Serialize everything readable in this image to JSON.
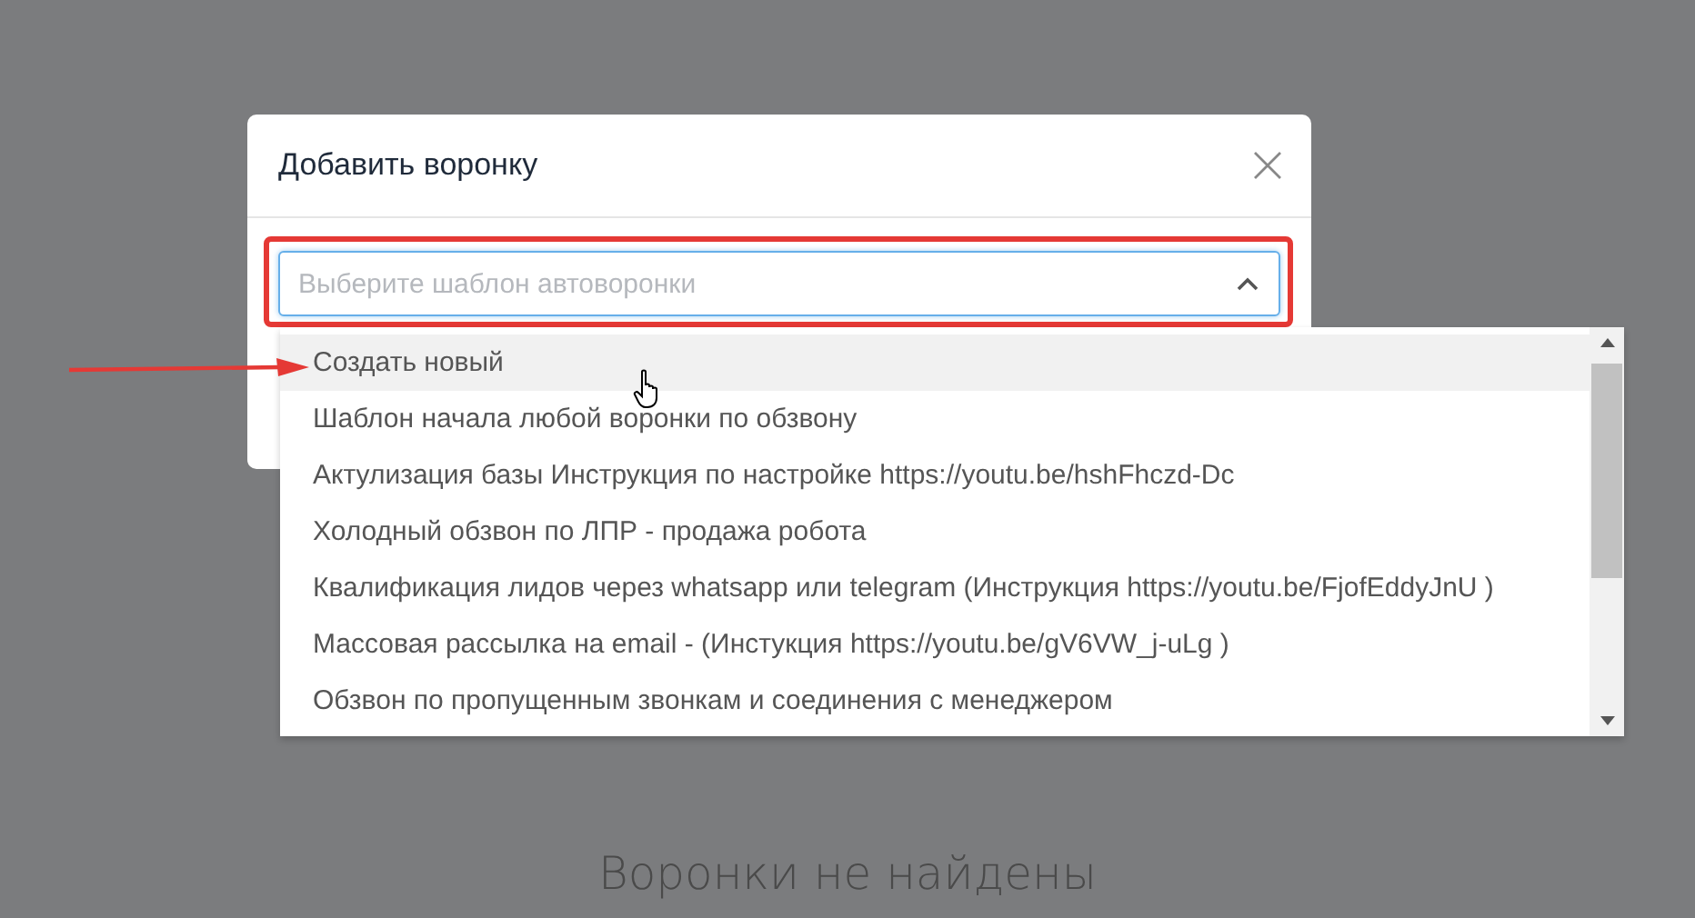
{
  "page": {
    "empty_message": "Воронки не найдены"
  },
  "modal": {
    "title": "Добавить воронку",
    "select": {
      "placeholder": "Выберите шаблон автоворонки",
      "expanded": true
    },
    "options": [
      {
        "label": "Создать новый",
        "highlighted": true
      },
      {
        "label": "Шаблон начала любой воронки по обзвону",
        "highlighted": false
      },
      {
        "label": "Актулизация базы Инструкция по настройке https://youtu.be/hshFhczd-Dc",
        "highlighted": false
      },
      {
        "label": "Холодный обзвон по ЛПР - продажа робота",
        "highlighted": false
      },
      {
        "label": "Квалификация лидов через whatsapp или telegram (Инструкция https://youtu.be/FjofEddyJnU )",
        "highlighted": false
      },
      {
        "label": " Массовая рассылка на email - (Инстукция https://youtu.be/gV6VW_j-uLg )",
        "highlighted": false
      },
      {
        "label": "Обзвон по пропущенным звонкам и соединения с менеджером",
        "highlighted": false
      }
    ]
  }
}
